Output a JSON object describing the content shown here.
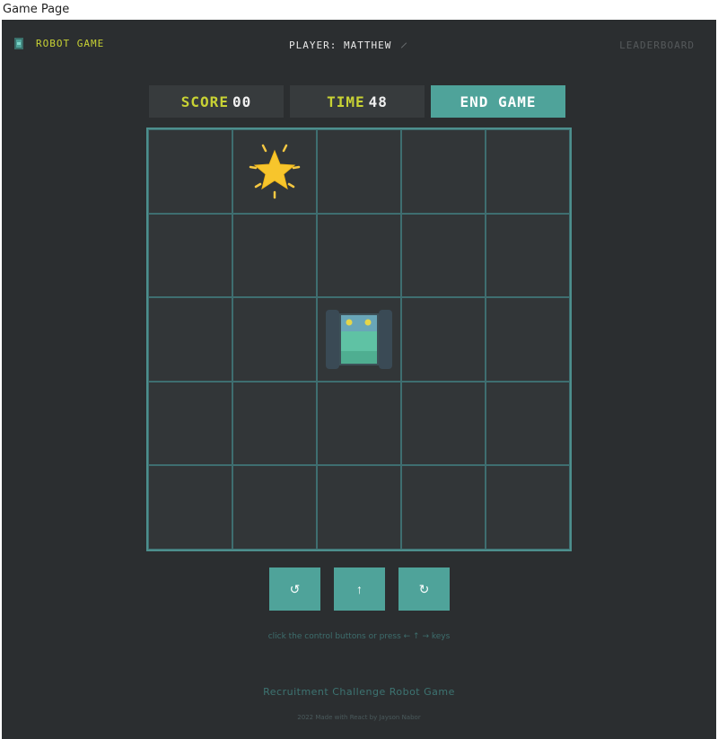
{
  "window": {
    "title": "Game Page"
  },
  "nav": {
    "logo_text": "ROBOT GAME",
    "player_label": "PLAYER: MATTHEW",
    "leaderboard_label": "LEADERBOARD"
  },
  "stats": {
    "score_label": "SCORE",
    "score_value": "00",
    "time_label": "TIME",
    "time_value": "48",
    "end_game_label": "END GAME"
  },
  "board": {
    "rows": 5,
    "cols": 5,
    "star": {
      "row": 0,
      "col": 1
    },
    "robot": {
      "row": 2,
      "col": 2,
      "facing": "up"
    }
  },
  "controls": {
    "rotate_left_icon": "rotate-left-icon",
    "forward_icon": "arrow-up-icon",
    "rotate_right_icon": "rotate-right-icon",
    "rotate_left_glyph": "↺",
    "forward_glyph": "↑",
    "rotate_right_glyph": "↻"
  },
  "hint": "click the control buttons or press ← ↑ → keys",
  "footer": {
    "title": "Recruitment Challenge Robot Game",
    "subtitle": "2022 Made with React by Jayson Nabor"
  },
  "colors": {
    "accent": "#4fa39a",
    "yellow": "#c8d234",
    "background": "#2b2e30"
  }
}
